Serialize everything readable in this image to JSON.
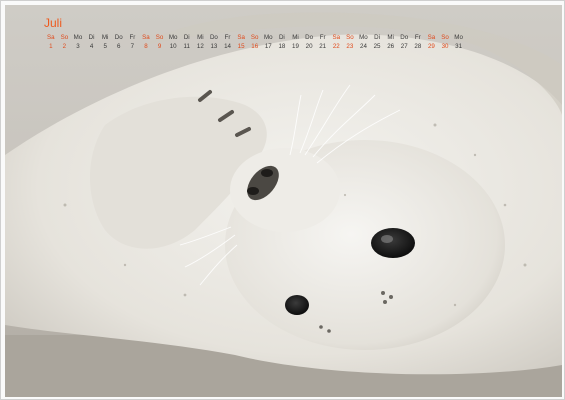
{
  "calendar": {
    "month": "Juli",
    "weekdays": [
      "Sa",
      "So",
      "Mo",
      "Di",
      "Mi",
      "Do",
      "Fr",
      "Sa",
      "So",
      "Mo",
      "Di",
      "Mi",
      "Do",
      "Fr",
      "Sa",
      "So",
      "Mo",
      "Di",
      "Mi",
      "Do",
      "Fr",
      "Sa",
      "So",
      "Mo",
      "Di",
      "Mi",
      "Do",
      "Fr",
      "Sa",
      "So",
      "Mo"
    ],
    "days": [
      "1",
      "2",
      "3",
      "4",
      "5",
      "6",
      "7",
      "8",
      "9",
      "10",
      "11",
      "12",
      "13",
      "14",
      "15",
      "16",
      "17",
      "18",
      "19",
      "20",
      "21",
      "22",
      "23",
      "24",
      "25",
      "26",
      "27",
      "28",
      "29",
      "30",
      "31"
    ]
  },
  "colors": {
    "accent": "#ee5a1e",
    "weekday_text": "#3a3a3a",
    "weekend_text": "#e0491a",
    "sand": "#b8b2a8",
    "fur": "#e9e7e1"
  },
  "photo": {
    "subject": "seal-pup-lying-on-sand"
  }
}
